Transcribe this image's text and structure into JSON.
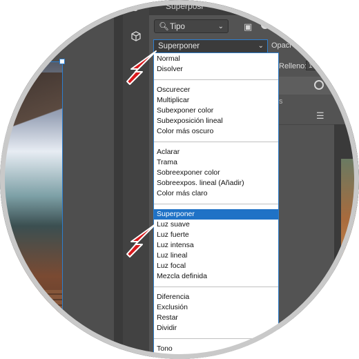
{
  "panel": {
    "title": "Superposi",
    "filter": {
      "icon": "search-icon",
      "label": "Tipo"
    },
    "blend_mode": {
      "selected": "Superponer"
    },
    "opacity_label": "Opaci",
    "fill_label": "Relleno:",
    "fill_value": "1",
    "row_hint": "s"
  },
  "dropdown": {
    "groups": [
      [
        "Normal",
        "Disolver"
      ],
      [
        "Oscurecer",
        "Multiplicar",
        "Subexponer color",
        "Subexposición lineal",
        "Color más oscuro"
      ],
      [
        "Aclarar",
        "Trama",
        "Sobreexponer color",
        "Sobreexpos. lineal (Añadir)",
        "Color más claro"
      ],
      [
        "Superponer",
        "Luz suave",
        "Luz fuerte",
        "Luz intensa",
        "Luz lineal",
        "Luz focal",
        "Mezcla definida"
      ],
      [
        "Diferencia",
        "Exclusión",
        "Restar",
        "Dividir"
      ],
      [
        "Tono"
      ]
    ],
    "selected": "Superponer"
  },
  "icons": {
    "tool_top": "brush-history-icon",
    "tool_3d": "cube-3d-icon",
    "image_filter": "image-filter-icon",
    "adjust": "sliders-icon",
    "link": "link-circle-icon",
    "arrow": "red-pointer-arrow"
  },
  "colors": {
    "selection": "#1f72c6",
    "focus_border": "#2e7fce",
    "arrow": "#d7191c"
  }
}
